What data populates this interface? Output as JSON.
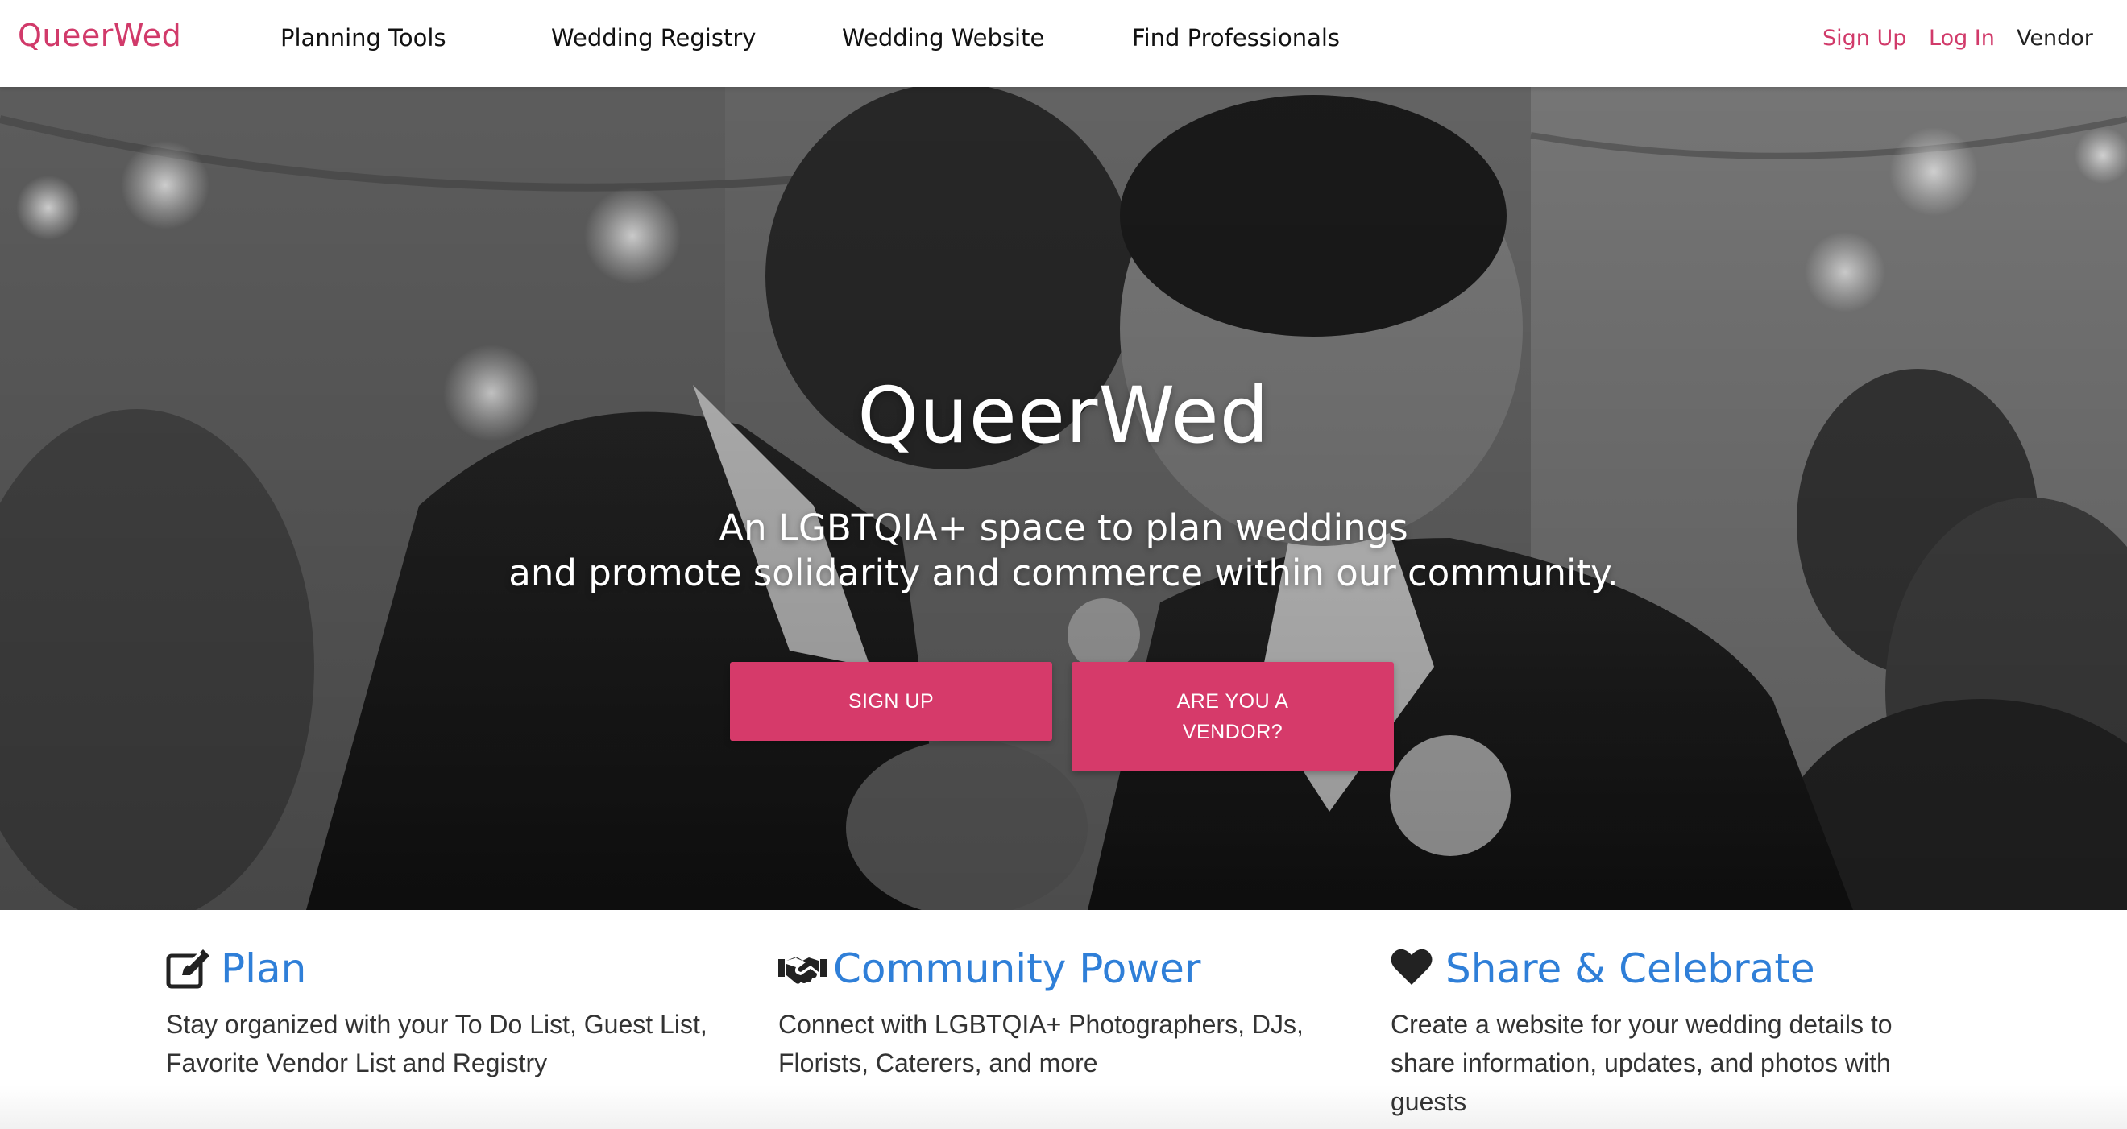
{
  "brand": "QueerWed",
  "nav": {
    "links": [
      "Planning Tools",
      "Wedding Registry",
      "Wedding Website",
      "Find Professionals"
    ],
    "sign_up": "Sign Up",
    "log_in": "Log In",
    "vendor": "Vendor"
  },
  "hero": {
    "title": "QueerWed",
    "subtitle_line1": "An LGBTQIA+ space to plan weddings",
    "subtitle_line2": "and promote solidarity and commerce within our community.",
    "cta_signup": "SIGN UP",
    "cta_vendor": "ARE YOU A VENDOR?"
  },
  "features": [
    {
      "icon": "edit-icon",
      "title": "Plan",
      "text": "Stay organized with your To Do List, Guest List, Favorite Vendor List and Registry"
    },
    {
      "icon": "handshake-icon",
      "title": "Community Power",
      "text": "Connect with LGBTQIA+ Photographers, DJs, Florists, Caterers, and more"
    },
    {
      "icon": "heart-icon",
      "title": "Share & Celebrate",
      "text": "Create a website for your wedding details to share information, updates, and photos with guests"
    }
  ],
  "colors": {
    "brand_pink": "#d13a6a",
    "button_pink": "#d63a6a",
    "feature_blue": "#2f7fd8"
  }
}
